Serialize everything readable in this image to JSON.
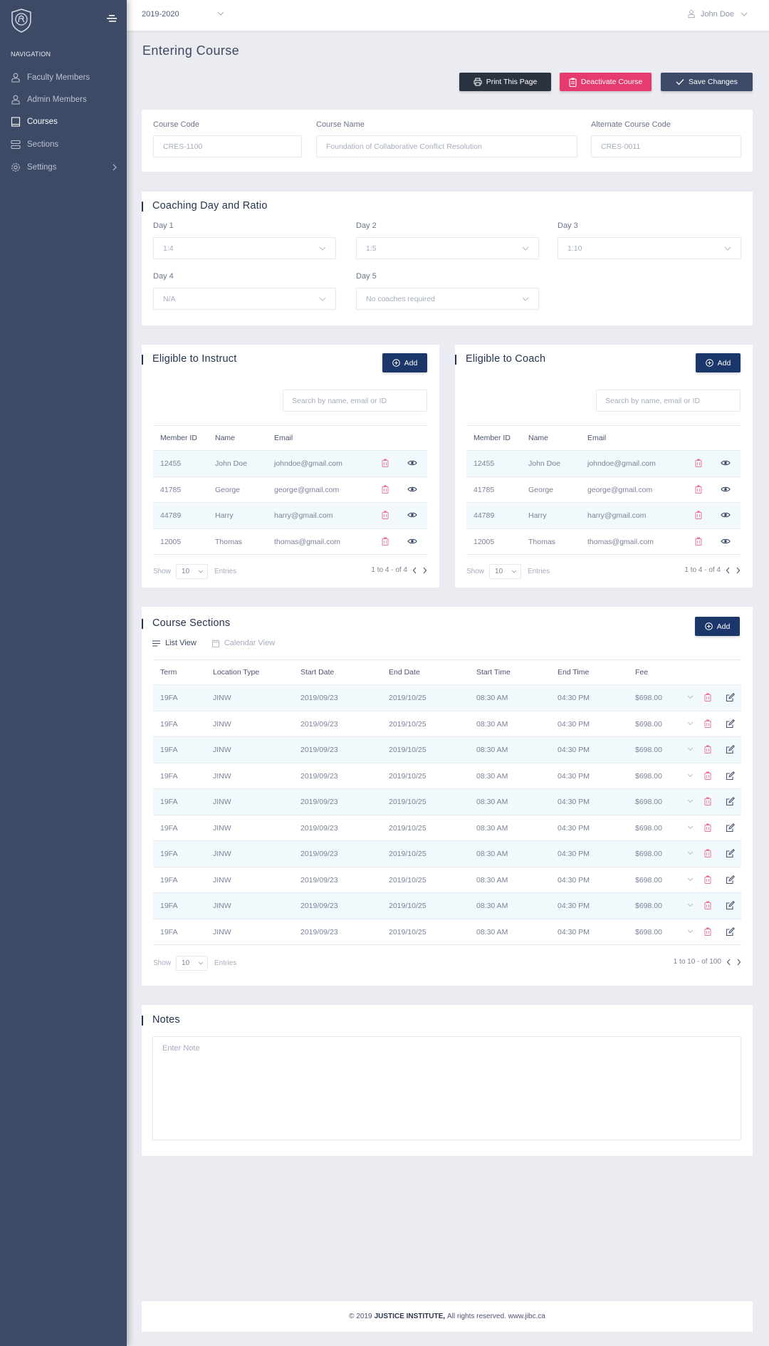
{
  "app": {
    "logo_icon": "shield-lion-logo-icon",
    "menu_toggle_icon": "menu-toggle-icon"
  },
  "sidebar": {
    "section_label": "NAVIGATION",
    "items": [
      {
        "label": "Faculty Members",
        "icon": "user-icon",
        "active": false
      },
      {
        "label": "Admin Members",
        "icon": "user-icon",
        "active": false
      },
      {
        "label": "Courses",
        "icon": "book-icon",
        "active": true
      },
      {
        "label": "Sections",
        "icon": "layers-icon",
        "active": false
      },
      {
        "label": "Settings",
        "icon": "gear-icon",
        "active": false,
        "has_submenu": true
      }
    ]
  },
  "topbar": {
    "year": "2019-2020",
    "user_name": "John Doe"
  },
  "page": {
    "title": "Entering Course",
    "actions": {
      "print": "Print This Page",
      "deactivate": "Deactivate Course",
      "save": "Save Changes"
    }
  },
  "course_info": {
    "code_label": "Course Code",
    "code_placeholder": "CRES-1100",
    "name_label": "Course Name",
    "name_placeholder": "Foundation of Collaborative Conflict Resolution",
    "alt_label": "Alternate Course Code",
    "alt_placeholder": "CRES-0011"
  },
  "coaching": {
    "title": "Coaching Day and Ratio",
    "days": [
      {
        "label": "Day 1",
        "value": "1:4"
      },
      {
        "label": "Day 2",
        "value": "1:5"
      },
      {
        "label": "Day 3",
        "value": "1:10"
      },
      {
        "label": "Day 4",
        "value": "N/A"
      },
      {
        "label": "Day 5",
        "value": "No coaches required"
      }
    ]
  },
  "instruct": {
    "title": "Eligible to Instruct",
    "add_label": "Add",
    "search_placeholder": "Search by name, email or ID",
    "columns": [
      "Member ID",
      "Name",
      "Email"
    ],
    "rows": [
      {
        "id": "12455",
        "name": "John Doe",
        "email": "johndoe@gmail.com"
      },
      {
        "id": "41785",
        "name": "George",
        "email": "george@gmail.com"
      },
      {
        "id": "44789",
        "name": "Harry",
        "email": "harry@gmail.com"
      },
      {
        "id": "12005",
        "name": "Thomas",
        "email": "thomas@gmail.com"
      }
    ],
    "show_label": "Show",
    "page_size": "10",
    "entries_label": "Entries",
    "range": "1 to 4 - of  4"
  },
  "coach": {
    "title": "Eligible to Coach",
    "add_label": "Add",
    "search_placeholder": "Search by name, email or ID",
    "columns": [
      "Member ID",
      "Name",
      "Email"
    ],
    "rows": [
      {
        "id": "12455",
        "name": "John Doe",
        "email": "johndoe@gmail.com"
      },
      {
        "id": "41785",
        "name": "George",
        "email": "george@gmail.com"
      },
      {
        "id": "44789",
        "name": "Harry",
        "email": "harry@gmail.com"
      },
      {
        "id": "12005",
        "name": "Thomas",
        "email": "thomas@gmail.com"
      }
    ],
    "show_label": "Show",
    "page_size": "10",
    "entries_label": "Entries",
    "range": "1 to 4 - of  4"
  },
  "sections": {
    "title": "Course Sections",
    "add_label": "Add",
    "views": {
      "list": "List View",
      "calendar": "Calendar View"
    },
    "columns": [
      "Term",
      "Location Type",
      "Start Date",
      "End Date",
      "Start Time",
      "End Time",
      "Fee"
    ],
    "rows": [
      {
        "term": "19FA",
        "location": "JINW",
        "start_date": "2019/09/23",
        "end_date": "2019/10/25",
        "start_time": "08:30 AM",
        "end_time": "04:30 PM",
        "fee": "$698.00"
      },
      {
        "term": "19FA",
        "location": "JINW",
        "start_date": "2019/09/23",
        "end_date": "2019/10/25",
        "start_time": "08:30 AM",
        "end_time": "04:30 PM",
        "fee": "$698.00"
      },
      {
        "term": "19FA",
        "location": "JINW",
        "start_date": "2019/09/23",
        "end_date": "2019/10/25",
        "start_time": "08:30 AM",
        "end_time": "04:30 PM",
        "fee": "$698.00"
      },
      {
        "term": "19FA",
        "location": "JINW",
        "start_date": "2019/09/23",
        "end_date": "2019/10/25",
        "start_time": "08:30 AM",
        "end_time": "04:30 PM",
        "fee": "$698.00"
      },
      {
        "term": "19FA",
        "location": "JINW",
        "start_date": "2019/09/23",
        "end_date": "2019/10/25",
        "start_time": "08:30 AM",
        "end_time": "04:30 PM",
        "fee": "$698.00"
      },
      {
        "term": "19FA",
        "location": "JINW",
        "start_date": "2019/09/23",
        "end_date": "2019/10/25",
        "start_time": "08:30 AM",
        "end_time": "04:30 PM",
        "fee": "$698.00"
      },
      {
        "term": "19FA",
        "location": "JINW",
        "start_date": "2019/09/23",
        "end_date": "2019/10/25",
        "start_time": "08:30 AM",
        "end_time": "04:30 PM",
        "fee": "$698.00"
      },
      {
        "term": "19FA",
        "location": "JINW",
        "start_date": "2019/09/23",
        "end_date": "2019/10/25",
        "start_time": "08:30 AM",
        "end_time": "04:30 PM",
        "fee": "$698.00"
      },
      {
        "term": "19FA",
        "location": "JINW",
        "start_date": "2019/09/23",
        "end_date": "2019/10/25",
        "start_time": "08:30 AM",
        "end_time": "04:30 PM",
        "fee": "$698.00"
      },
      {
        "term": "19FA",
        "location": "JINW",
        "start_date": "2019/09/23",
        "end_date": "2019/10/25",
        "start_time": "08:30 AM",
        "end_time": "04:30 PM",
        "fee": "$698.00"
      }
    ],
    "show_label": "Show",
    "page_size": "10",
    "entries_label": "Entries",
    "range": "1 to 10 - of  100"
  },
  "notes": {
    "title": "Notes",
    "placeholder": "Enter Note"
  },
  "footer": {
    "prefix": "© 2019",
    "org": "JUSTICE INSTITUTE,",
    "suffix": "All rights reserved. www.jibc.ca"
  },
  "colors": {
    "sidebar": "#3d4a66",
    "primary": "#1b3668",
    "danger": "#e63b6f",
    "dark": "#2c3340",
    "save": "#3e4b68",
    "row_alt": "#f2f9fc"
  }
}
